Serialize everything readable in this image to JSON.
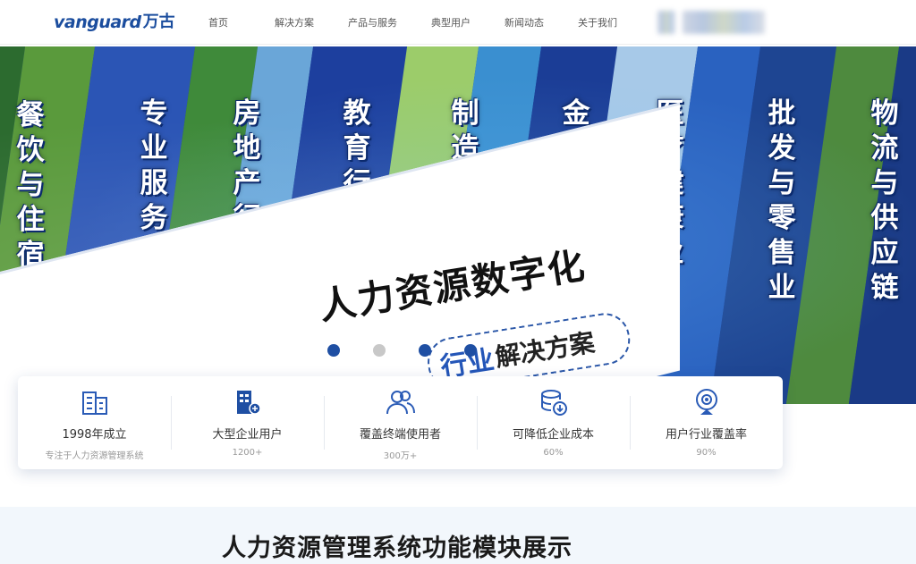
{
  "brand": {
    "name_en": "vanguard",
    "name_cn": "万古",
    "color": "#1b4d9e"
  },
  "nav": [
    "首页",
    "解决方案",
    "产品与服务",
    "典型用户",
    "新闻动态",
    "关于我们"
  ],
  "banner": {
    "industries": [
      "餐饮与住宿业",
      "专业服务业",
      "房地产行业",
      "教育行业",
      "制造业",
      "金融业",
      "医疗健康业",
      "批发与零售业",
      "物流与供应链"
    ],
    "headline": "人力资源数字化",
    "subline_highlight": "行业",
    "subline_rest": "解决方案",
    "carousel_colors": [
      "#1f4fa3",
      "#c8c8c8",
      "#1f4fa3",
      "#1f4fa3"
    ],
    "active_slide": 1
  },
  "stats": [
    {
      "icon": "building-icon",
      "title": "1998年成立",
      "sub": "专注于人力资源管理系统"
    },
    {
      "icon": "enterprise-icon",
      "title": "大型企业用户",
      "sub": "1200+"
    },
    {
      "icon": "users-icon",
      "title": "覆盖终端使用者",
      "sub": "300万+"
    },
    {
      "icon": "coin-down-icon",
      "title": "可降低企业成本",
      "sub": "60%"
    },
    {
      "icon": "target-pin-icon",
      "title": "用户行业覆盖率",
      "sub": "90%"
    }
  ],
  "section_title": "人力资源管理系统功能模块展示",
  "accent": "#1f4fa3"
}
